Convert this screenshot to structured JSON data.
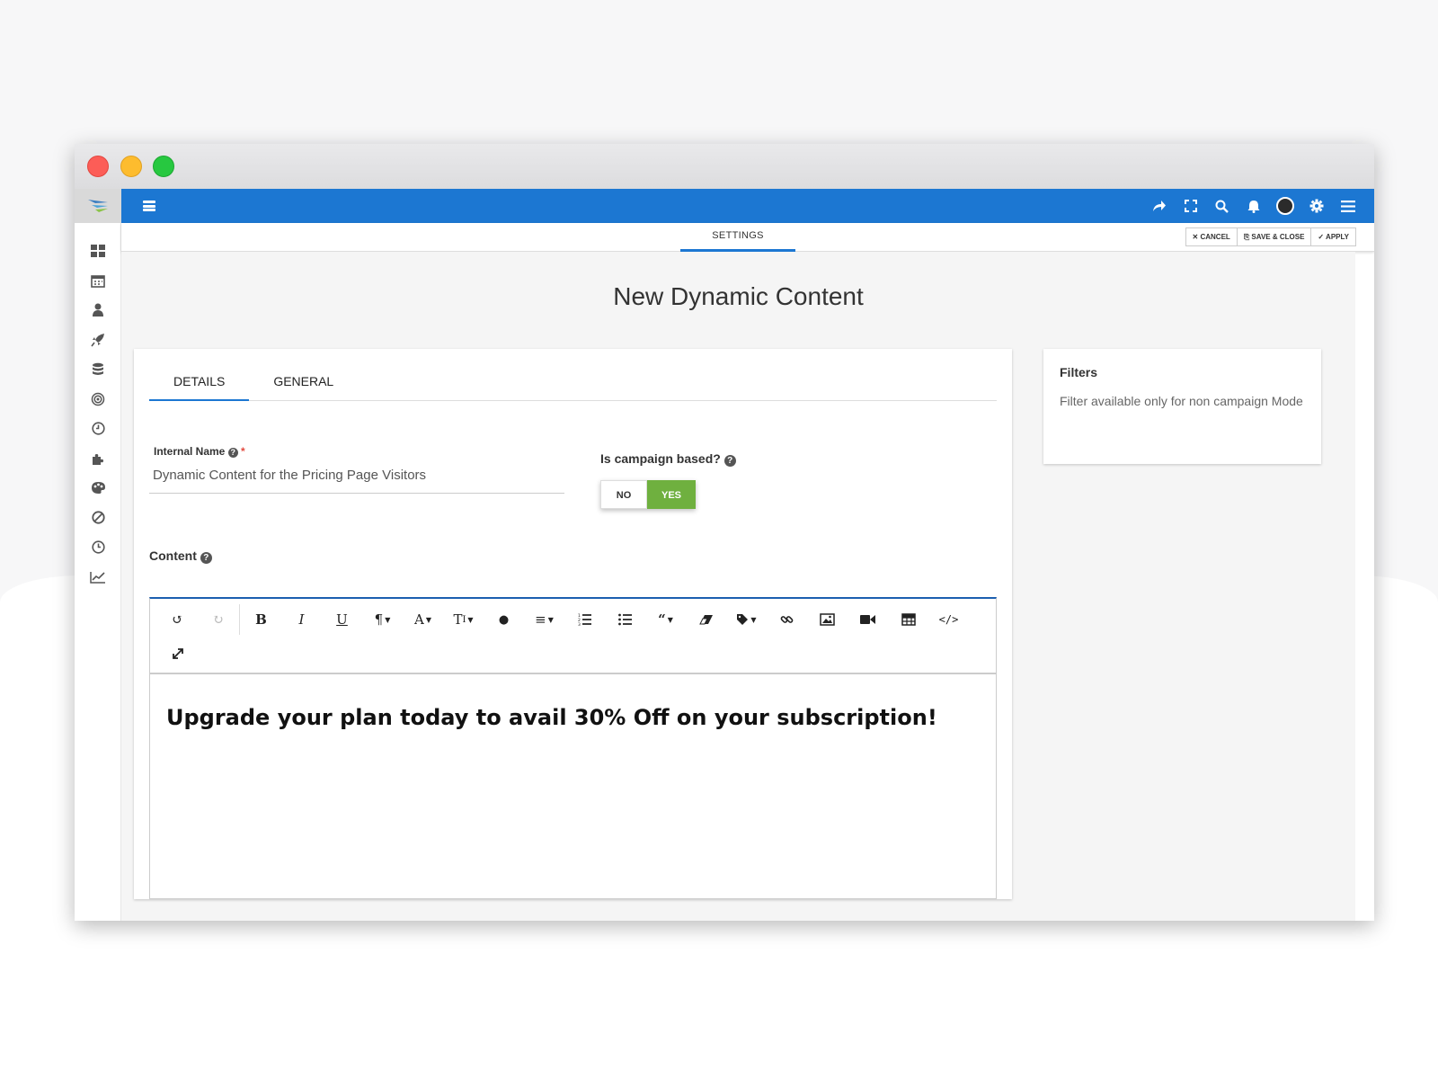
{
  "topbar": {
    "icons": [
      "share-icon",
      "fullscreen-icon",
      "search-icon",
      "bell-icon",
      "avatar",
      "gear-icon",
      "menu-icon"
    ]
  },
  "subbar": {
    "tab_label": "SETTINGS",
    "cancel_label": "✕ CANCEL",
    "save_close_label": "⎘ SAVE & CLOSE",
    "apply_label": "✓ APPLY"
  },
  "page": {
    "title": "New Dynamic Content"
  },
  "tabs": {
    "details": "DETAILS",
    "general": "GENERAL"
  },
  "form": {
    "internal_name_label": "Internal Name",
    "internal_name_value": "Dynamic Content for the Pricing Page Visitors",
    "campaign_label": "Is campaign based?",
    "toggle_no": "NO",
    "toggle_yes": "YES",
    "content_label": "Content"
  },
  "editor": {
    "content": "Upgrade your plan today to avail 30% Off on your subscription!"
  },
  "filters": {
    "title": "Filters",
    "text": "Filter available only for non campaign Mode"
  },
  "colors": {
    "primary": "#1c77d2",
    "toggle_on": "#6fb03f"
  }
}
